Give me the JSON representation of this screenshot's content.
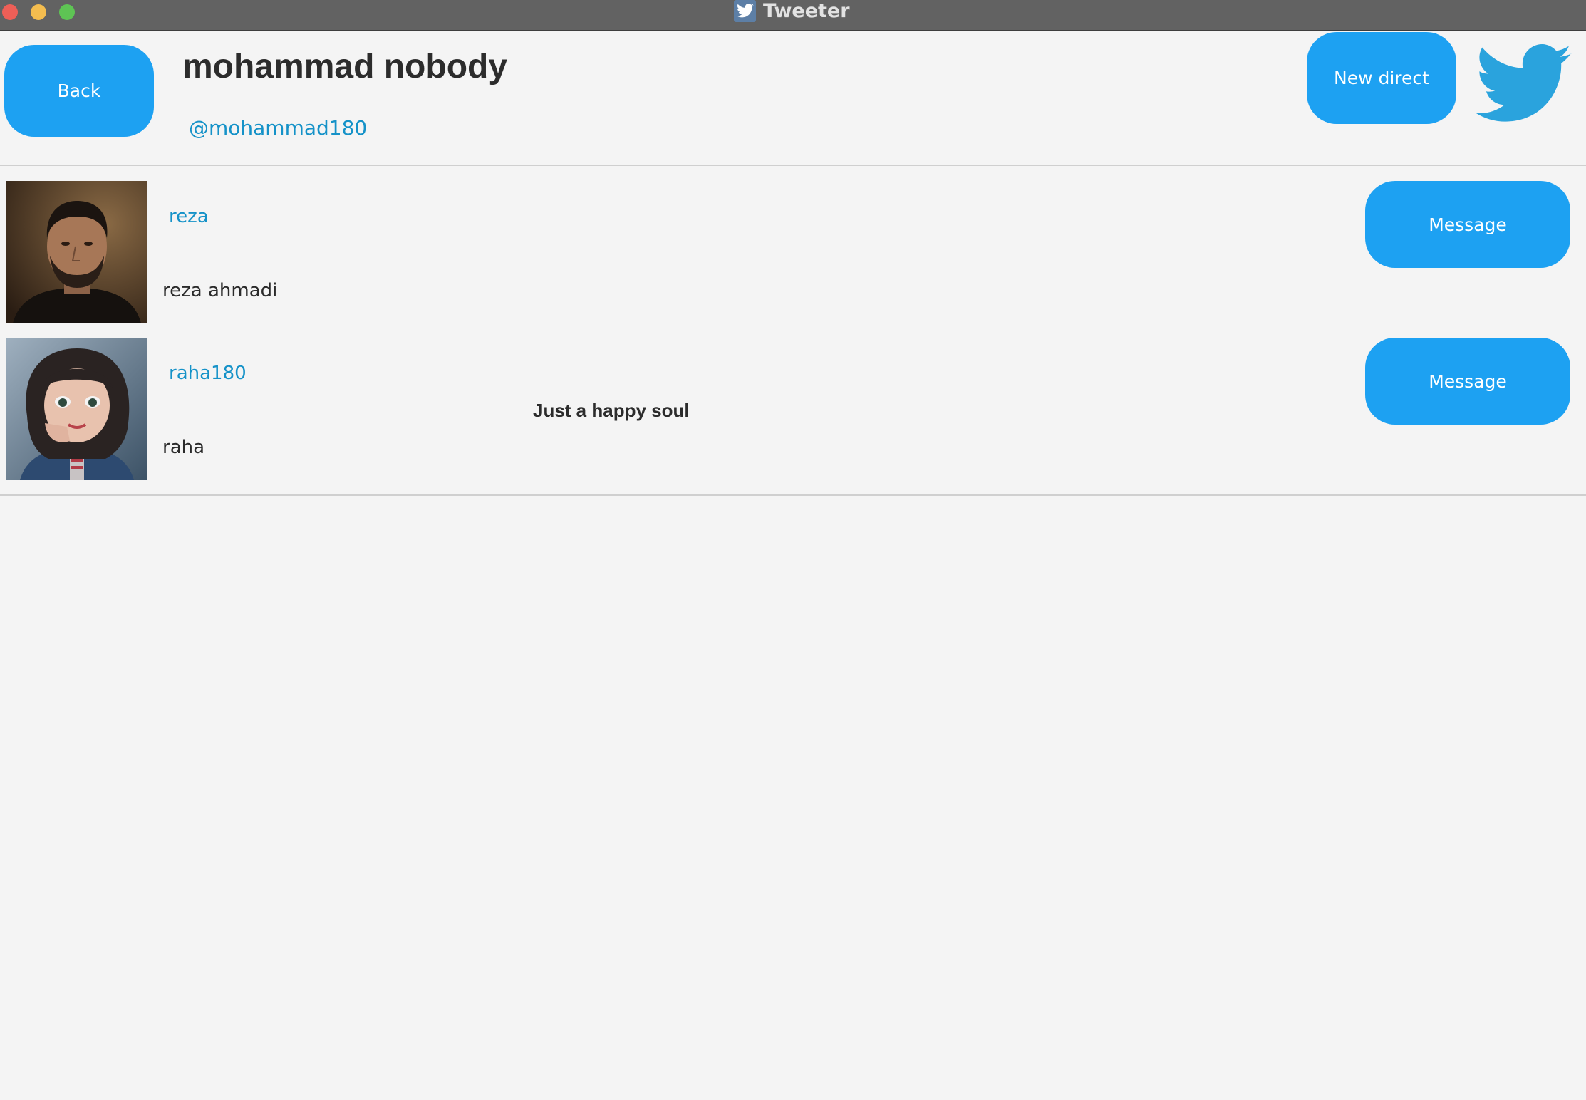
{
  "window": {
    "title": "Tweeter",
    "app_icon": "twitter-bird-icon"
  },
  "header": {
    "back_label": "Back",
    "name": "mohammad nobody",
    "handle": "@mohammad180",
    "new_direct_label": "New direct",
    "logo_icon": "twitter-bird-icon"
  },
  "users": [
    {
      "username": "reza",
      "full_name": "reza ahmadi",
      "bio": "",
      "message_label": "Message"
    },
    {
      "username": "raha180",
      "full_name": "raha",
      "bio": "Just a happy soul",
      "message_label": "Message"
    }
  ],
  "colors": {
    "accent": "#1da1f2",
    "link": "#1592c8",
    "background": "#f4f4f4",
    "titlebar": "#626262"
  }
}
